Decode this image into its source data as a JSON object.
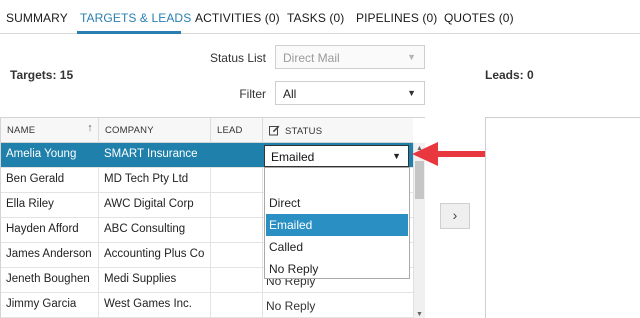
{
  "tabs": [
    {
      "label": "SUMMARY"
    },
    {
      "label": "TARGETS & LEADS"
    },
    {
      "label": "ACTIVITIES (0)"
    },
    {
      "label": "TASKS (0)"
    },
    {
      "label": "PIPELINES (0)"
    },
    {
      "label": "QUOTES (0)"
    }
  ],
  "active_tab": "TARGETS & LEADS",
  "targets": {
    "label": "Targets: 15"
  },
  "leads": {
    "label": "Leads: 0"
  },
  "filters": {
    "status_list_label": "Status List",
    "status_list_value": "Direct Mail",
    "filter_label": "Filter",
    "filter_value": "All"
  },
  "grid": {
    "columns": [
      {
        "label": "NAME"
      },
      {
        "label": "COMPANY"
      },
      {
        "label": "LEAD"
      },
      {
        "label": "STATUS"
      }
    ],
    "rows": [
      {
        "name": "Amelia Young",
        "company": "SMART Insurance",
        "status": "Emailed"
      },
      {
        "name": "Ben Gerald",
        "company": "MD Tech Pty Ltd",
        "status": ""
      },
      {
        "name": "Ella Riley",
        "company": "AWC Digital Corp",
        "status": ""
      },
      {
        "name": "Hayden Afford",
        "company": "ABC Consulting",
        "status": ""
      },
      {
        "name": "James Anderson",
        "company": "Accounting Plus Co",
        "status": ""
      },
      {
        "name": "Jeneth Boughen",
        "company": "Medi Supplies",
        "status": "No Reply"
      },
      {
        "name": "Jimmy Garcia",
        "company": "West Games Inc.",
        "status": "No Reply"
      }
    ]
  },
  "status_dropdown": {
    "current": "Emailed",
    "options": [
      "",
      "Direct",
      "Emailed",
      "Called",
      "No Reply"
    ],
    "highlighted": "Emailed"
  },
  "buttons": {
    "move_right": "›"
  },
  "colors": {
    "accent": "#2a7fb1",
    "selected_row": "#1f80ac",
    "dropdown_highlight": "#2a8fc3",
    "annotation_arrow": "#e8373e"
  },
  "icons": {
    "sort": "sort-ascending-icon",
    "edit": "edit-icon"
  }
}
